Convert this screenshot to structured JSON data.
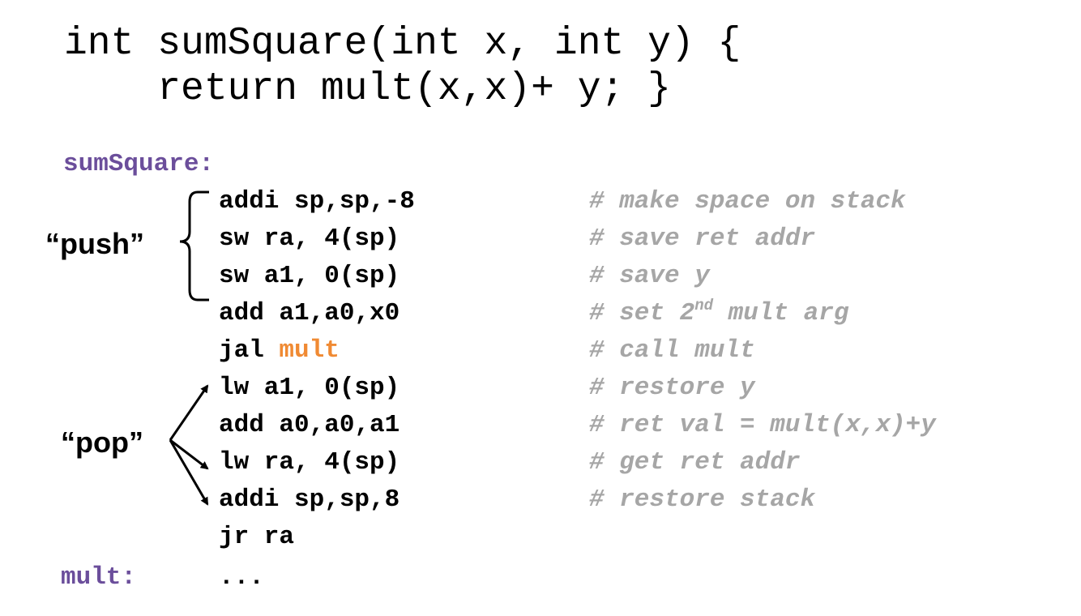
{
  "c_source": {
    "line1": "int sumSquare(int x, int y) {",
    "line2": "    return mult(x,x)+ y; }"
  },
  "labels": {
    "sumsquare": "sumSquare:",
    "mult": "mult:"
  },
  "instructions": [
    {
      "text": "addi sp,sp,-8",
      "comment": "# make space on stack"
    },
    {
      "text": "sw ra, 4(sp)",
      "comment": "# save ret addr"
    },
    {
      "text": "sw a1, 0(sp)",
      "comment": "# save y"
    },
    {
      "text": "add a1,a0,x0",
      "comment_pre": "# set 2",
      "comment_sup": "nd",
      "comment_post": " mult arg"
    },
    {
      "op": "jal ",
      "target": "mult",
      "comment": "# call mult"
    },
    {
      "text": "lw a1, 0(sp)",
      "comment": "# restore y"
    },
    {
      "text": "add a0,a0,a1",
      "comment": "# ret val = mult(x,x)+y"
    },
    {
      "text": "lw ra, 4(sp)",
      "comment": "# get ret addr"
    },
    {
      "text": "addi sp,sp,8",
      "comment": "# restore stack"
    },
    {
      "text": "jr ra"
    },
    {
      "text": "..."
    }
  ],
  "annotations": {
    "push": "“push”",
    "pop": "“pop”"
  },
  "colors": {
    "label": "#6b4e9b",
    "call_target": "#f08a33",
    "comment": "#a6a6a6",
    "code": "#000000"
  }
}
